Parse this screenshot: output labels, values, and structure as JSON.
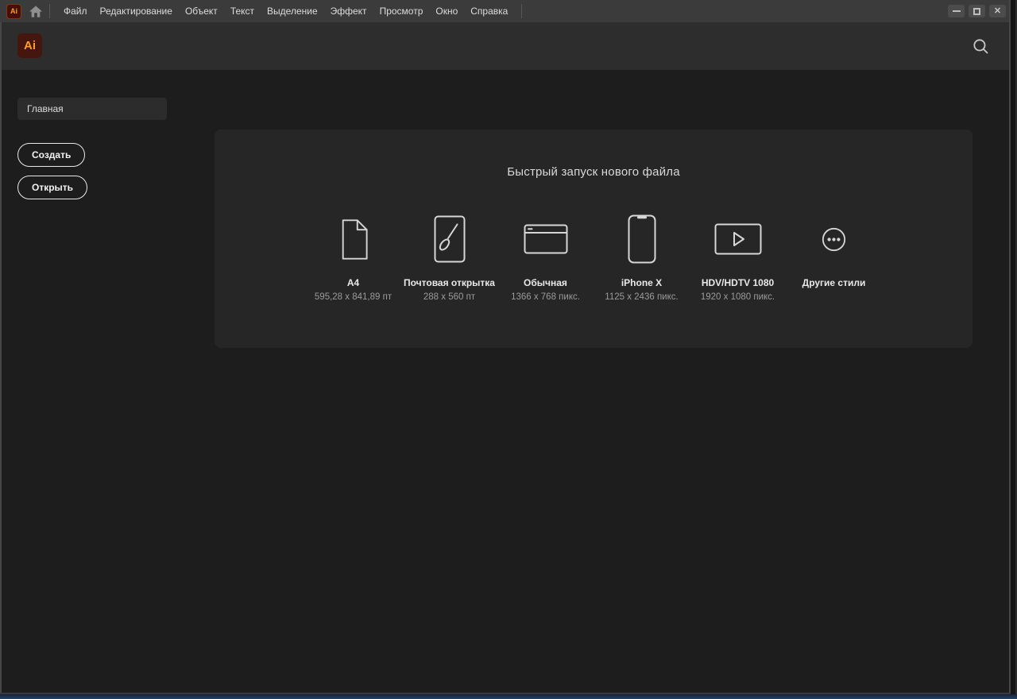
{
  "titlebar": {
    "app_icon_text": "Ai",
    "menu": [
      "Файл",
      "Редактирование",
      "Объект",
      "Текст",
      "Выделение",
      "Эффект",
      "Просмотр",
      "Окно",
      "Справка"
    ],
    "controls": {
      "minimize": "",
      "maximize": "",
      "close": "✕"
    }
  },
  "header": {
    "logo_text": "Ai",
    "search_icon": "search-icon"
  },
  "sidebar": {
    "nav": [
      {
        "label": "Главная",
        "selected": true
      }
    ],
    "create_label": "Создать",
    "open_label": "Открыть"
  },
  "quickstart": {
    "title": "Быстрый запуск нового файла",
    "templates": [
      {
        "name": "A4",
        "size": "595,28 x 841,89 пт",
        "icon": "document-icon"
      },
      {
        "name": "Почтовая открытка",
        "size": "288 x 560 пт",
        "icon": "postcard-brush-icon"
      },
      {
        "name": "Обычная",
        "size": "1366 x 768 пикс.",
        "icon": "browser-window-icon"
      },
      {
        "name": "iPhone X",
        "size": "1125 x 2436 пикс.",
        "icon": "phone-icon"
      },
      {
        "name": "HDV/HDTV 1080",
        "size": "1920 x 1080 пикс.",
        "icon": "video-play-icon"
      },
      {
        "name": "Другие стили",
        "size": "",
        "icon": "more-ellipsis-icon"
      }
    ]
  },
  "colors": {
    "titlebar_bg": "#3b3b3b",
    "header_bg": "#2d2d2d",
    "content_bg": "#1d1d1d",
    "panel_bg": "#262626",
    "logo_bg": "#45160d",
    "logo_text": "#ff9d2c",
    "icon_stroke": "#d6d6d6",
    "taskbar_blue": "#25416b"
  }
}
